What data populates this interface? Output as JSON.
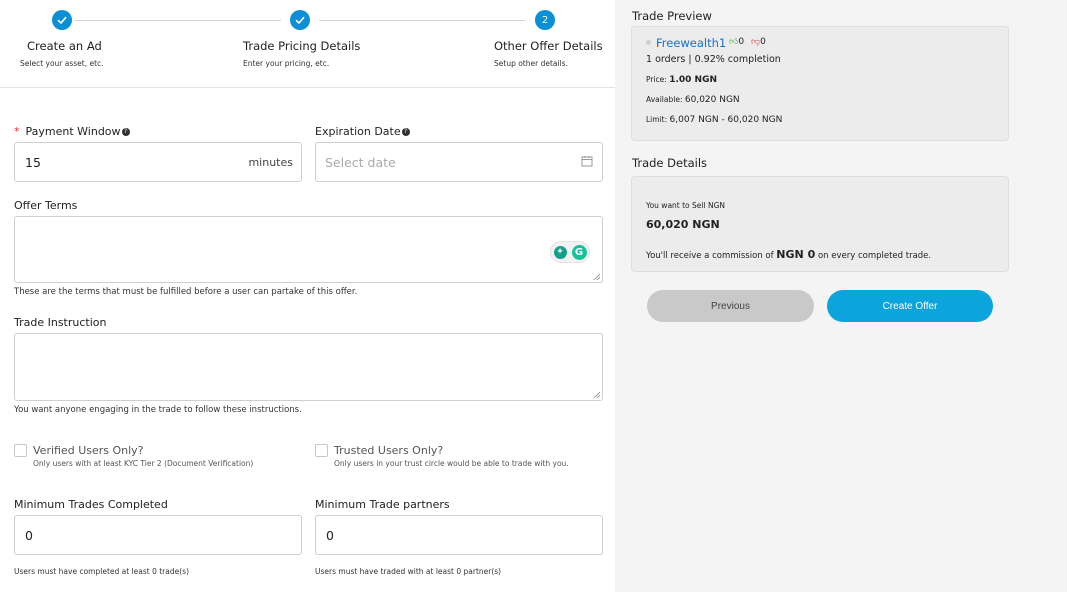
{
  "stepper": {
    "steps": [
      {
        "title": "Create an Ad",
        "subtitle": "Select your asset, etc.",
        "state": "done"
      },
      {
        "title": "Trade Pricing Details",
        "subtitle": "Enter your pricing, etc.",
        "state": "done"
      },
      {
        "title": "Other Offer Details",
        "subtitle": "Setup other details.",
        "state": "current",
        "number": "2"
      }
    ],
    "accent_color": "#0d8fd6"
  },
  "form": {
    "payment_window": {
      "label": "Payment Window",
      "required_mark": "*",
      "value": "15",
      "suffix": "minutes"
    },
    "expiration_date": {
      "label": "Expiration Date",
      "placeholder": "Select date"
    },
    "offer_terms": {
      "label": "Offer Terms",
      "hint": "These are the terms that must be fulfilled before a user can partake of this offer."
    },
    "trade_instruction": {
      "label": "Trade Instruction",
      "hint": "You want anyone engaging in the trade to follow these instructions."
    },
    "verified_users": {
      "label": "Verified Users Only?",
      "hint": "Only users with at least KYC Tier 2 (Document Verification)"
    },
    "trusted_users": {
      "label": "Trusted Users Only?",
      "hint": "Only users in your trust circle would be able to trade with you."
    },
    "min_trades": {
      "label": "Minimum Trades Completed",
      "value": "0",
      "hint": "Users must have completed at least 0 trade(s)"
    },
    "min_partners": {
      "label": "Minimum Trade partners",
      "value": "0",
      "hint": "Users must have traded with at least 0 partner(s)"
    }
  },
  "preview": {
    "heading": "Trade Preview",
    "username": "Freewealth1",
    "thumbs_up": "0",
    "thumbs_down": "0",
    "orders_line": "1 orders | 0.92% completion",
    "price_label": "Price:",
    "price_value": "1.00 NGN",
    "available_label": "Available:",
    "available_value": "60,020 NGN",
    "limit_label": "Limit:",
    "limit_value": "6,007 NGN - 60,020 NGN"
  },
  "details": {
    "heading": "Trade Details",
    "want_text": "You want to Sell NGN",
    "amount": "60,020 NGN",
    "commission_prefix": "You'll receive a commission of",
    "commission_value": "NGN 0",
    "commission_suffix": "on every completed trade."
  },
  "actions": {
    "previous_label": "Previous",
    "create_label": "Create Offer",
    "create_color": "#0ca4dd"
  }
}
